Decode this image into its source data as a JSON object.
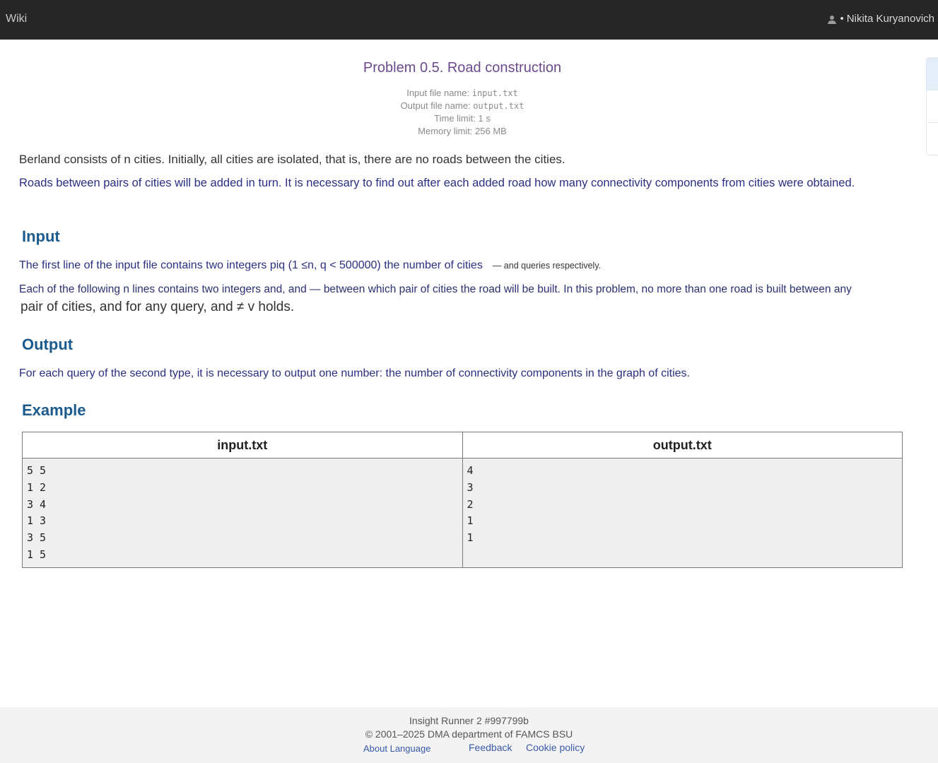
{
  "topbar": {
    "wiki_label": "Wiki",
    "user_dot": "•",
    "user_name": "Nikita Kuryanovich"
  },
  "problem": {
    "title": "Problem 0.5. Road construction",
    "input_file_label": "Input file name:",
    "input_file": "input.txt",
    "output_file_label": "Output file name:",
    "output_file": "output.txt",
    "time_limit": "Time limit: 1 s",
    "memory_limit": "Memory limit: 256 MB"
  },
  "statement": {
    "p1": "Berland consists of n cities. Initially, all cities are isolated, that is, there are no roads between the cities.",
    "p2": "Roads between pairs of cities will be added in turn. It is necessary to find out after each added road how many connectivity components from cities were obtained."
  },
  "input_section": {
    "heading": "Input",
    "p1": "The first line of the input file contains two integers piq (1 ≤n, q < 500000) the number of cities",
    "p1_small": "— and queries respectively.",
    "p2": "Each of the following n lines contains two integers and, and — between which pair of cities the road will be built. In this problem, no more than one road is built between any",
    "p3": "pair of cities, and for any query, and ≠ v holds."
  },
  "output_section": {
    "heading": "Output",
    "p1": "For each query of the second type, it is necessary to output one number: the number of connectivity components in the graph of cities."
  },
  "example": {
    "heading": "Example",
    "input_header": "input.txt",
    "output_header": "output.txt",
    "input_lines": [
      "5 5",
      "1 2",
      "3 4",
      "1 3",
      "3 5",
      "1 5"
    ],
    "output_lines": [
      "4",
      "3",
      "2",
      "1",
      "1"
    ]
  },
  "footer": {
    "line1": "Insight Runner 2 #997799b",
    "line2": "© 2001–2025 DMA department of FAMCS BSU",
    "about": "About Language",
    "feedback": "Feedback",
    "cookie": "Cookie policy"
  }
}
